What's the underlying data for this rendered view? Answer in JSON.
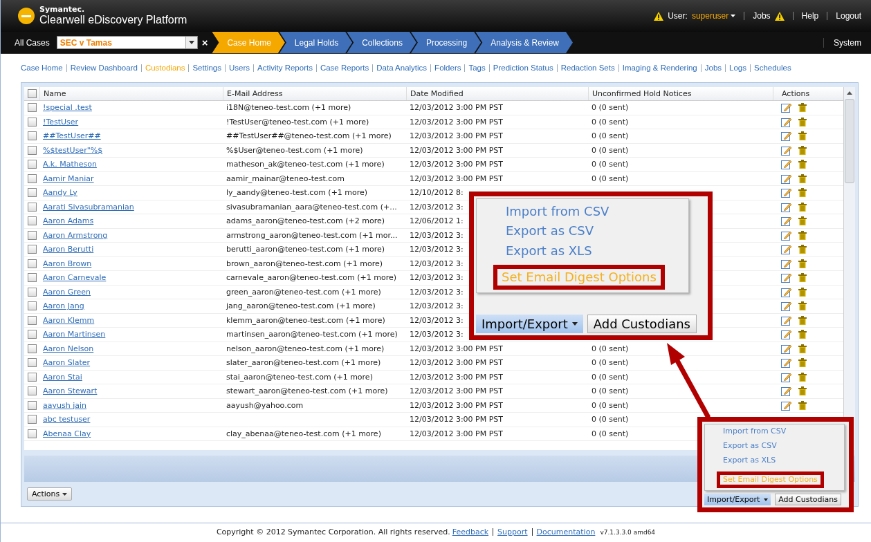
{
  "header": {
    "brand": "Symantec.",
    "product": "Clearwell eDiscovery Platform",
    "user_label": "User:",
    "user": "superuser",
    "jobs": "Jobs",
    "help": "Help",
    "logout": "Logout"
  },
  "nav": {
    "all_cases": "All Cases",
    "case_select": "SEC v Tamas",
    "clear": "×",
    "system": "System",
    "steps": [
      {
        "label": "Case Home",
        "selected": true
      },
      {
        "label": "Legal Holds",
        "selected": false
      },
      {
        "label": "Collections",
        "selected": false
      },
      {
        "label": "Processing",
        "selected": false
      },
      {
        "label": "Analysis & Review",
        "selected": false
      }
    ]
  },
  "links": [
    {
      "label": "Case Home",
      "selected": false
    },
    {
      "label": "Review Dashboard",
      "selected": false
    },
    {
      "label": "Custodians",
      "selected": true
    },
    {
      "label": "Settings",
      "selected": false
    },
    {
      "label": "Users",
      "selected": false
    },
    {
      "label": "Activity Reports",
      "selected": false
    },
    {
      "label": "Case Reports",
      "selected": false
    },
    {
      "label": "Data Analytics",
      "selected": false
    },
    {
      "label": "Folders",
      "selected": false
    },
    {
      "label": "Tags",
      "selected": false
    },
    {
      "label": "Prediction Status",
      "selected": false
    },
    {
      "label": "Redaction Sets",
      "selected": false
    },
    {
      "label": "Imaging & Rendering",
      "selected": false
    },
    {
      "label": "Jobs",
      "selected": false
    },
    {
      "label": "Logs",
      "selected": false
    },
    {
      "label": "Schedules",
      "selected": false
    }
  ],
  "table": {
    "columns": [
      "Name",
      "E-Mail Address",
      "Date Modified",
      "Unconfirmed Hold Notices",
      "Actions"
    ],
    "select_all_checked": false,
    "rows": [
      {
        "checked": false,
        "name": "!special  .test",
        "email": "i18N@teneo-test.com (+1 more)",
        "date": "12/03/2012 3:00 PM PST",
        "notices": "0 (0 sent)",
        "actions": true
      },
      {
        "checked": false,
        "name": "!TestUser",
        "email": "!TestUser@teneo-test.com (+1 more)",
        "date": "12/03/2012 3:00 PM PST",
        "notices": "0 (0 sent)",
        "actions": true
      },
      {
        "checked": false,
        "name": "##TestUser##",
        "email": "##TestUser##@teneo-test.com (+1 more)",
        "date": "12/03/2012 3:00 PM PST",
        "notices": "0 (0 sent)",
        "actions": true
      },
      {
        "checked": false,
        "name": "%$testUser\"%$",
        "email": "%$User@teneo-test.com (+1 more)",
        "date": "12/03/2012 3:00 PM PST",
        "notices": "0 (0 sent)",
        "actions": true
      },
      {
        "checked": false,
        "name": "A.k. Matheson",
        "email": "matheson_ak@teneo-test.com (+1 more)",
        "date": "12/03/2012 3:00 PM PST",
        "notices": "0 (0 sent)",
        "actions": true
      },
      {
        "checked": false,
        "name": "Aamir Maniar",
        "email": "aamir_mainar@teneo-test.com",
        "date": "12/03/2012 3:00 PM PST",
        "notices": "0 (0 sent)",
        "actions": true
      },
      {
        "checked": false,
        "name": "Aandy Ly",
        "email": "ly_aandy@teneo-test.com (+1 more)",
        "date": "12/10/2012 8:",
        "actions": true
      },
      {
        "checked": false,
        "name": "Aarati Sivasubramanian",
        "email": "sivasubramanian_aara@teneo-test.com (+...",
        "date": "12/03/2012 3:",
        "actions": true
      },
      {
        "checked": false,
        "name": "Aaron Adams",
        "email": "adams_aaron@teneo-test.com (+2 more)",
        "date": "12/06/2012 1:",
        "actions": true
      },
      {
        "checked": false,
        "name": "Aaron Armstrong",
        "email": "armstrong_aaron@teneo-test.com (+1 mor...",
        "date": "12/03/2012 3:",
        "actions": true
      },
      {
        "checked": false,
        "name": "Aaron Berutti",
        "email": "berutti_aaron@teneo-test.com (+1 more)",
        "date": "12/03/2012 3:",
        "actions": true
      },
      {
        "checked": false,
        "name": "Aaron Brown",
        "email": "brown_aaron@teneo-test.com (+1 more)",
        "date": "12/03/2012 3:",
        "actions": true
      },
      {
        "checked": false,
        "name": "Aaron Carnevale",
        "email": "carnevale_aaron@teneo-test.com (+1 more)",
        "date": "12/03/2012 3:",
        "actions": true
      },
      {
        "checked": false,
        "name": "Aaron Green",
        "email": "green_aaron@teneo-test.com (+1 more)",
        "date": "12/03/2012 3:",
        "actions": true
      },
      {
        "checked": false,
        "name": "Aaron Jang",
        "email": "jang_aaron@teneo-test.com (+1 more)",
        "date": "12/03/2012 3:",
        "actions": true
      },
      {
        "checked": false,
        "name": "Aaron Klemm",
        "email": "klemm_aaron@teneo-test.com (+1 more)",
        "date": "12/03/2012 3:",
        "actions": true
      },
      {
        "checked": false,
        "name": "Aaron Martinsen",
        "email": "martinsen_aaron@teneo-test.com (+1 more)",
        "date": "12/03/2012 3:",
        "actions": true
      },
      {
        "checked": false,
        "name": "Aaron Nelson",
        "email": "nelson_aaron@teneo-test.com (+1 more)",
        "date": "12/03/2012 3:00 PM PST",
        "notices": "0 (0 sent)",
        "actions": true
      },
      {
        "checked": false,
        "name": "Aaron Slater",
        "email": "slater_aaron@teneo-test.com (+1 more)",
        "date": "12/03/2012 3:00 PM PST",
        "notices": "0 (0 sent)",
        "actions": true
      },
      {
        "checked": false,
        "name": "Aaron Stai",
        "email": "stai_aaron@teneo-test.com (+1 more)",
        "date": "12/03/2012 3:00 PM PST",
        "notices": "0 (0 sent)",
        "actions": true
      },
      {
        "checked": false,
        "name": "Aaron Stewart",
        "email": "stewart_aaron@teneo-test.com (+1 more)",
        "date": "12/03/2012 3:00 PM PST",
        "notices": "0 (0 sent)",
        "actions": true
      },
      {
        "checked": false,
        "name": "aayush jain",
        "email": "aayush@yahoo.com",
        "date": "12/03/2012 3:00 PM PST",
        "notices": "0 (0 sent)",
        "actions": true
      },
      {
        "checked": false,
        "name": "abc testuser",
        "date": "12/03/2012 3:00 PM PST",
        "notices": "0 (0 sent)"
      },
      {
        "checked": false,
        "name": "Abenaa Clay",
        "email": "clay_abenaa@teneo-test.com (+1 more)",
        "date": "12/03/2012 3:00 PM PST",
        "notices": "0 (0 sent)"
      }
    ]
  },
  "actions_button": "Actions",
  "callout_large": {
    "menu": [
      {
        "label": "Import from CSV",
        "selected": false
      },
      {
        "label": "Export as CSV",
        "selected": false
      },
      {
        "label": "Export as XLS",
        "selected": false
      },
      {
        "label": "Set Email Digest Options",
        "selected": true
      }
    ],
    "buttons": [
      "Import/Export",
      "Add Custodians"
    ]
  },
  "callout_small": {
    "menu": [
      {
        "label": "Import from CSV",
        "selected": false
      },
      {
        "label": "Export as CSV",
        "selected": false
      },
      {
        "label": "Export as XLS",
        "selected": false
      },
      {
        "label": "Set Email Digest Options",
        "selected": true
      }
    ],
    "buttons": [
      "Import/Export",
      "Add Custodians"
    ]
  },
  "footer": {
    "copyright": "Copyright © 2012 Symantec Corporation. All rights reserved.",
    "links": [
      "Feedback",
      "Support",
      "Documentation"
    ],
    "version": "v7.1.3.3.0 amd64"
  }
}
